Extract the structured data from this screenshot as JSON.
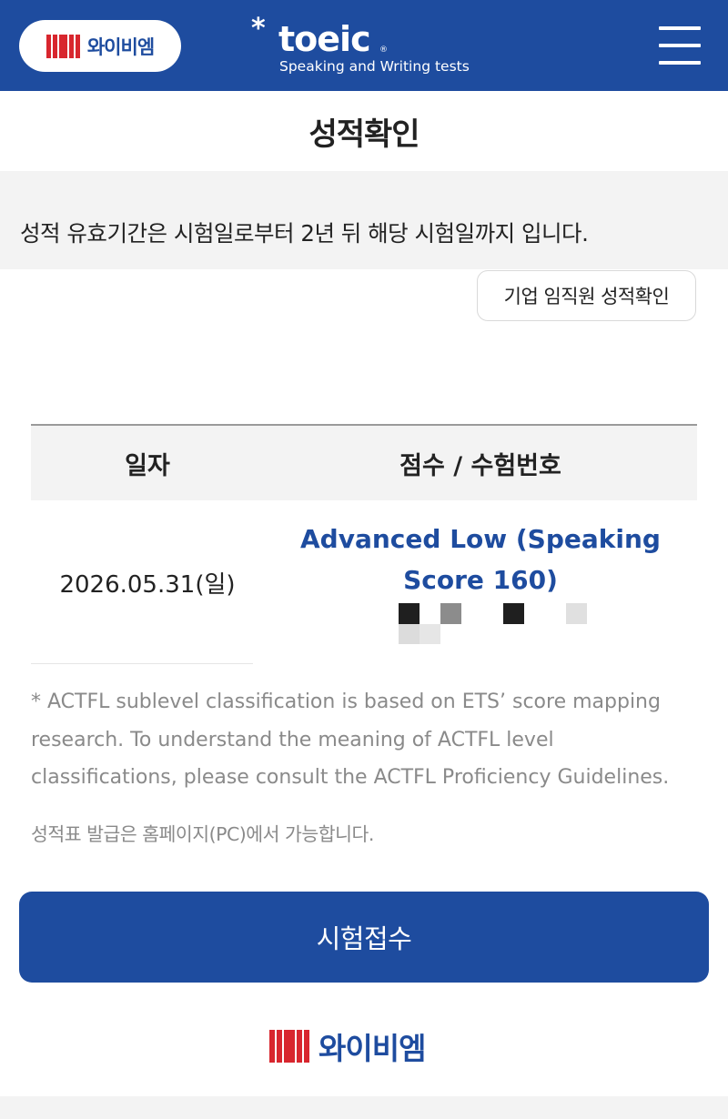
{
  "header": {
    "brand_text": "와이비엠",
    "toeic_star": "*",
    "toeic_word": "toeic",
    "toeic_reg": "®",
    "toeic_subtitle": "Speaking and Writing tests",
    "menu_icon": "hamburger-menu-icon"
  },
  "page": {
    "title": "성적확인",
    "notice": "성적 유효기간은 시험일로부터 2년 뒤 해당 시험일까지 입니다.",
    "corp_button_label": "기업 임직원 성적확인"
  },
  "table": {
    "columns": [
      "일자",
      "점수 / 수험번호"
    ],
    "rows": [
      {
        "date": "2026.05.31(일)",
        "score": "Advanced Low (Speaking Score 160)",
        "exam_number_masked": true
      }
    ]
  },
  "notes": {
    "footnote": "* ACTFL sublevel classification is based on ETS’ score mapping research. To understand the meaning of ACTFL level classifications, please consult the ACTFL Proficiency Guidelines.",
    "issue_note": "성적표 발급은 홈페이지(PC)에서 가능합니다."
  },
  "apply_button_label": "시험접수",
  "footer": {
    "brand_text": "와이비엠"
  },
  "colors": {
    "primary": "#1e4c9f",
    "brand_red": "#d8262e",
    "muted": "#8a8a8a",
    "band": "#f3f3f3"
  }
}
